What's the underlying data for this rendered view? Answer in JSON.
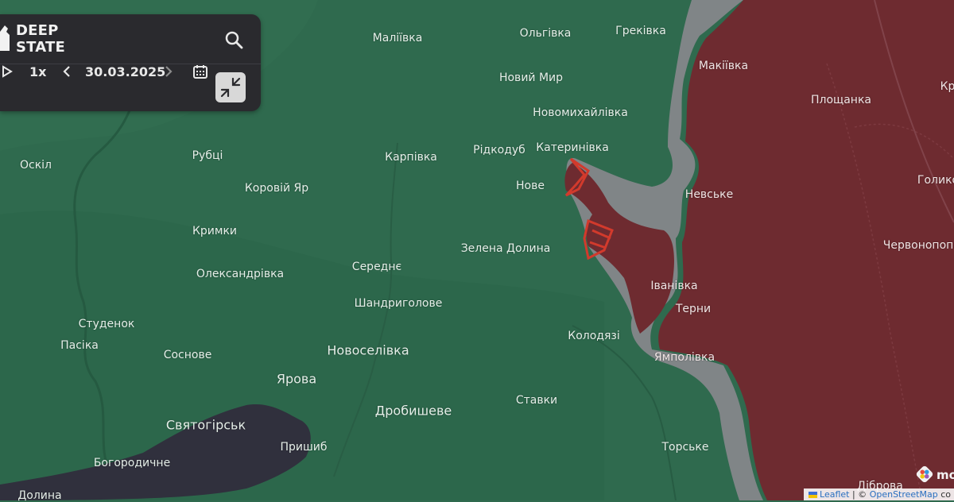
{
  "header": {
    "logo_line1": "DEEP",
    "logo_line2": "STATE",
    "speed": "1x",
    "date": "30.03.2025"
  },
  "colors": {
    "free_territory": "#2f6a4e",
    "occupied_territory": "#6e2b30",
    "grey_zone": "#8e8a92",
    "occupied_other": "#30303d",
    "advance_marker": "#d23a2c",
    "panel_bg": "#2a2a2e"
  },
  "places": [
    {
      "name": "Маліївка"
    },
    {
      "name": "Ольгівка"
    },
    {
      "name": "Греківка"
    },
    {
      "name": "Новий Мир"
    },
    {
      "name": "Новомихайлівка"
    },
    {
      "name": "Катеринівка"
    },
    {
      "name": "Рідкодуб"
    },
    {
      "name": "Карпівка"
    },
    {
      "name": "Рубці"
    },
    {
      "name": "Оскіл"
    },
    {
      "name": "Коровій Яр"
    },
    {
      "name": "Нове"
    },
    {
      "name": "Кримки"
    },
    {
      "name": "Зелена Долина"
    },
    {
      "name": "Середнє"
    },
    {
      "name": "Олександрівка"
    },
    {
      "name": "Шандриголове"
    },
    {
      "name": "Студенок"
    },
    {
      "name": "Пасіка"
    },
    {
      "name": "Соснове"
    },
    {
      "name": "Новоселівка"
    },
    {
      "name": "Колодязі"
    },
    {
      "name": "Ярова"
    },
    {
      "name": "Дробишеве"
    },
    {
      "name": "Ставки"
    },
    {
      "name": "Святогірськ"
    },
    {
      "name": "Пришиб"
    },
    {
      "name": "Богородичне"
    },
    {
      "name": "Долина"
    },
    {
      "name": "Торське"
    },
    {
      "name": "Макіївка"
    },
    {
      "name": "Площанка"
    },
    {
      "name": "Невське"
    },
    {
      "name": "Іванівка"
    },
    {
      "name": "Терни"
    },
    {
      "name": "Ямполівка"
    },
    {
      "name": "Голико"
    },
    {
      "name": "Червонопопі"
    },
    {
      "name": "Діброва"
    },
    {
      "name": "Кр"
    }
  ],
  "attribution": {
    "leaflet": "Leaflet",
    "separator": " | © ",
    "osm": "OpenStreetMap",
    "tail": " co"
  },
  "corner_logo": "mo",
  "icons": [
    "search-icon",
    "play-icon",
    "chevron-left-icon",
    "chevron-right-icon",
    "calendar-icon",
    "collapse-arrows-icon",
    "deepstate-logo-icon"
  ]
}
